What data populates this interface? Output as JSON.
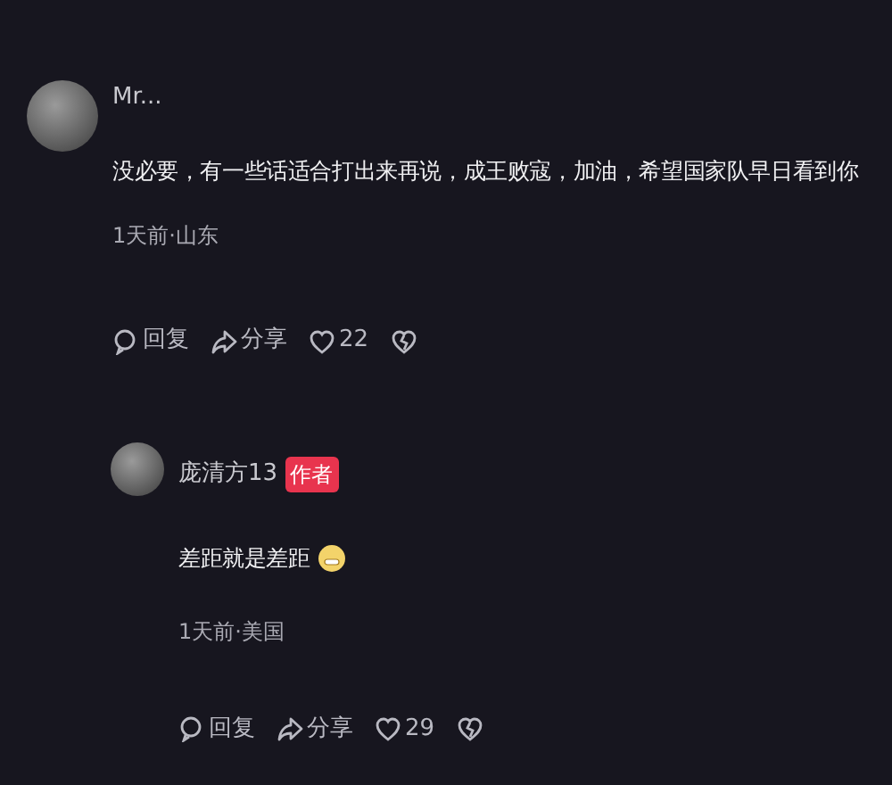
{
  "comments": [
    {
      "author": "Mr...",
      "text": "没必要，有一些话适合打出来再说，成王败寇，加油，希望国家队早日看到你",
      "meta": "1天前·山东",
      "actions": {
        "reply": "回复",
        "share": "分享",
        "likes": "22"
      },
      "emoji": false
    },
    {
      "author": "庞清方13",
      "badge": "作者",
      "text": "差距就是差距",
      "meta": "1天前·美国",
      "actions": {
        "reply": "回复",
        "share": "分享",
        "likes": "29"
      },
      "emoji": true
    }
  ]
}
